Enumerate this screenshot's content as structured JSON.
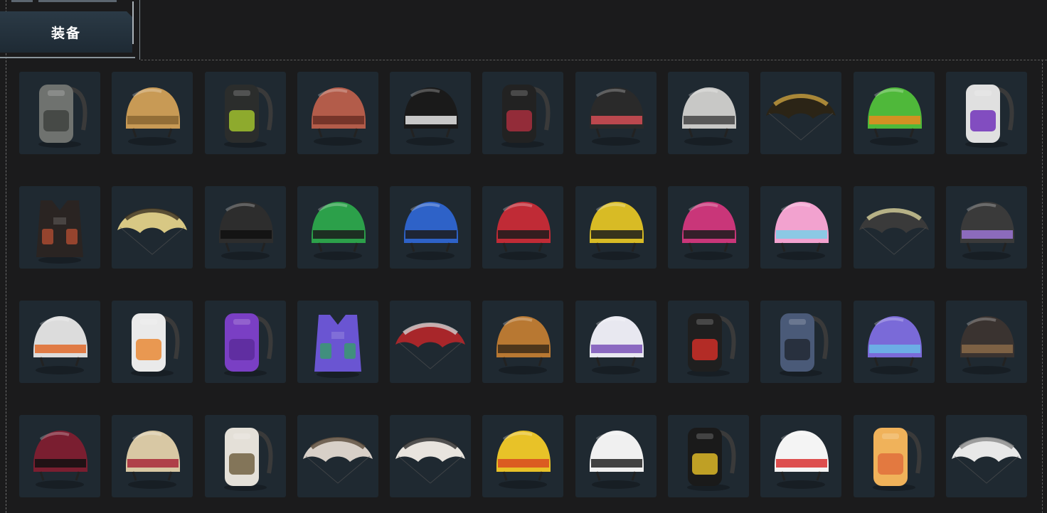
{
  "header": {
    "tab_label": "装备"
  },
  "grid": {
    "items": [
      {
        "kind": "backpack",
        "colors": [
          "#6f726f",
          "#3c3f3c"
        ],
        "name": "backpack-icon"
      },
      {
        "kind": "helmet",
        "colors": [
          "#c89a55",
          "#8a6633"
        ],
        "name": "helmet-icon"
      },
      {
        "kind": "backpack",
        "colors": [
          "#2b2d2c",
          "#a7c92e"
        ],
        "name": "backpack-icon"
      },
      {
        "kind": "helmet",
        "colors": [
          "#b35c4a",
          "#6b2e24"
        ],
        "name": "helmet-icon"
      },
      {
        "kind": "helmet",
        "colors": [
          "#1a1a1a",
          "#e8e8e8"
        ],
        "name": "helmet-icon"
      },
      {
        "kind": "backpack",
        "colors": [
          "#222222",
          "#b03040"
        ],
        "name": "backpack-icon"
      },
      {
        "kind": "helmet",
        "colors": [
          "#2a2a2a",
          "#d54d55"
        ],
        "name": "helmet-icon"
      },
      {
        "kind": "helmet",
        "colors": [
          "#c8c8c6",
          "#444444"
        ],
        "name": "helmet-icon"
      },
      {
        "kind": "parachute",
        "colors": [
          "#2b2416",
          "#c9a040"
        ],
        "name": "parachute-icon"
      },
      {
        "kind": "helmet",
        "colors": [
          "#4fb83a",
          "#e98a1f"
        ],
        "name": "helmet-icon"
      },
      {
        "kind": "backpack",
        "colors": [
          "#e0e0e0",
          "#6a28b8"
        ],
        "name": "backpack-icon"
      },
      {
        "kind": "vest",
        "colors": [
          "#2a2422",
          "#a84a30"
        ],
        "name": "vest-icon"
      },
      {
        "kind": "parachute",
        "colors": [
          "#d8c884",
          "#3a3020"
        ],
        "name": "parachute-icon"
      },
      {
        "kind": "helmet",
        "colors": [
          "#2d2d2d",
          "#111111"
        ],
        "name": "helmet-icon"
      },
      {
        "kind": "helmet",
        "colors": [
          "#2ca04a",
          "#1b1b1b"
        ],
        "name": "helmet-icon"
      },
      {
        "kind": "helmet",
        "colors": [
          "#2e62c8",
          "#1b1b1b"
        ],
        "name": "helmet-icon"
      },
      {
        "kind": "helmet",
        "colors": [
          "#c02b36",
          "#1b1b1b"
        ],
        "name": "helmet-icon"
      },
      {
        "kind": "helmet",
        "colors": [
          "#d8bb25",
          "#1b1b1b"
        ],
        "name": "helmet-icon"
      },
      {
        "kind": "helmet",
        "colors": [
          "#c93679",
          "#1b1b1b"
        ],
        "name": "helmet-icon"
      },
      {
        "kind": "helmet",
        "colors": [
          "#f2a2cf",
          "#7ad0e8"
        ],
        "name": "helmet-icon"
      },
      {
        "kind": "parachute",
        "colors": [
          "#3a3a3a",
          "#d6cf9a"
        ],
        "name": "parachute-icon"
      },
      {
        "kind": "helmet",
        "colors": [
          "#3a3a3a",
          "#9b74d4"
        ],
        "name": "helmet-icon"
      },
      {
        "kind": "helmet",
        "colors": [
          "#dcdcdc",
          "#e06a2a"
        ],
        "name": "helmet-icon"
      },
      {
        "kind": "backpack",
        "colors": [
          "#eaeaea",
          "#e8832a"
        ],
        "name": "backpack-icon"
      },
      {
        "kind": "backpack",
        "colors": [
          "#7a3fc4",
          "#5a2a98"
        ],
        "name": "backpack-icon"
      },
      {
        "kind": "vest",
        "colors": [
          "#6a55d2",
          "#3a9a70"
        ],
        "name": "vest-icon"
      },
      {
        "kind": "parachute",
        "colors": [
          "#a8262a",
          "#d0d0d0"
        ],
        "name": "parachute-icon"
      },
      {
        "kind": "helmet",
        "colors": [
          "#b87832",
          "#3b2a18"
        ],
        "name": "helmet-icon"
      },
      {
        "kind": "helmet",
        "colors": [
          "#e8e8f0",
          "#7a52b8"
        ],
        "name": "helmet-icon"
      },
      {
        "kind": "backpack",
        "colors": [
          "#1f1f1f",
          "#d83028"
        ],
        "name": "backpack-icon"
      },
      {
        "kind": "backpack",
        "colors": [
          "#4a5a78",
          "#1f2530"
        ],
        "name": "backpack-icon"
      },
      {
        "kind": "helmet",
        "colors": [
          "#7a6ad8",
          "#6ab8e8"
        ],
        "name": "helmet-icon"
      },
      {
        "kind": "helmet",
        "colors": [
          "#3a3330",
          "#8a6a48"
        ],
        "name": "helmet-icon"
      },
      {
        "kind": "helmet",
        "colors": [
          "#7a1e30",
          "#111111"
        ],
        "name": "helmet-icon"
      },
      {
        "kind": "helmet",
        "colors": [
          "#d8c8a4",
          "#a8283a"
        ],
        "name": "helmet-icon"
      },
      {
        "kind": "backpack",
        "colors": [
          "#e4e0d8",
          "#6a5a3a"
        ],
        "name": "backpack-icon"
      },
      {
        "kind": "parachute",
        "colors": [
          "#d8d0c8",
          "#5a4a3a"
        ],
        "name": "parachute-icon"
      },
      {
        "kind": "parachute",
        "colors": [
          "#e8e4de",
          "#2a2a2a"
        ],
        "name": "parachute-icon"
      },
      {
        "kind": "helmet",
        "colors": [
          "#e8c228",
          "#d84a20"
        ],
        "name": "helmet-icon"
      },
      {
        "kind": "helmet",
        "colors": [
          "#f0f0f0",
          "#222222"
        ],
        "name": "helmet-icon"
      },
      {
        "kind": "backpack",
        "colors": [
          "#1a1a1a",
          "#e8c228"
        ],
        "name": "backpack-icon"
      },
      {
        "kind": "helmet",
        "colors": [
          "#f4f4f4",
          "#d83030"
        ],
        "name": "helmet-icon"
      },
      {
        "kind": "backpack",
        "colors": [
          "#f0b25a",
          "#e06a3a"
        ],
        "name": "backpack-icon"
      },
      {
        "kind": "parachute",
        "colors": [
          "#e8e8e8",
          "#8a8a8a"
        ],
        "name": "parachute-icon"
      }
    ]
  }
}
